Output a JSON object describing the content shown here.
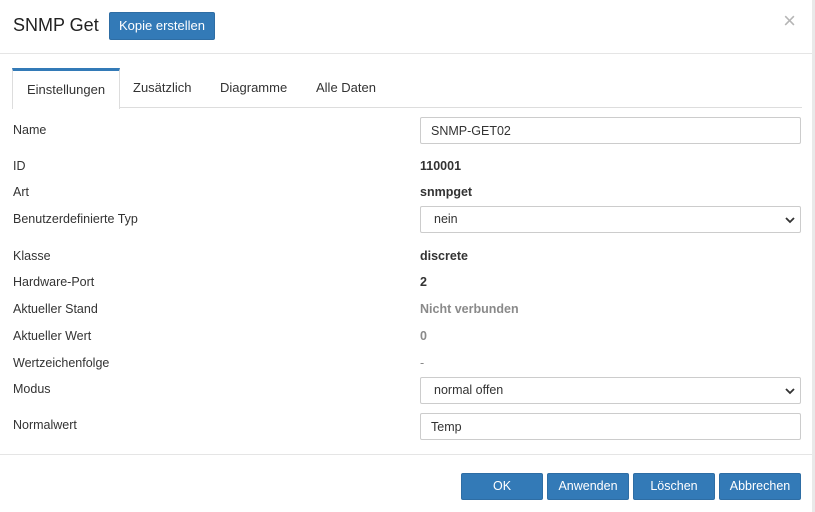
{
  "header": {
    "title": "SNMP Get",
    "copy_label": "Kopie erstellen",
    "close_glyph": "×"
  },
  "tabs": [
    {
      "label": "Einstellungen",
      "active": true
    },
    {
      "label": "Zusätzlich",
      "active": false
    },
    {
      "label": "Diagramme",
      "active": false
    },
    {
      "label": "Alle Daten",
      "active": false
    }
  ],
  "form": {
    "name": {
      "label": "Name",
      "value": "SNMP-GET02"
    },
    "id": {
      "label": "ID",
      "value": "110001"
    },
    "art": {
      "label": "Art",
      "value": "snmpget"
    },
    "custom_type": {
      "label": "Benutzerdefinierte Typ",
      "selected": "nein"
    },
    "klasse": {
      "label": "Klasse",
      "value": "discrete"
    },
    "hardware_port": {
      "label": "Hardware-Port",
      "value": "2"
    },
    "current_state": {
      "label": "Aktueller Stand",
      "value": "Nicht verbunden"
    },
    "current_value": {
      "label": "Aktueller Wert",
      "value": "0"
    },
    "value_string": {
      "label": "Wertzeichenfolge",
      "value": "-"
    },
    "mode": {
      "label": "Modus",
      "selected": "normal offen"
    },
    "normal_value": {
      "label": "Normalwert",
      "value": "Temp"
    }
  },
  "footer": {
    "ok": "OK",
    "apply": "Anwenden",
    "delete": "Löschen",
    "cancel": "Abbrechen"
  },
  "colors": {
    "primary": "#337ab7",
    "muted": "#8a8a8a"
  }
}
